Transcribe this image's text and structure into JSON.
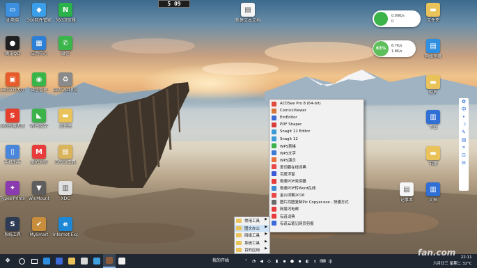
{
  "clock_widget": {
    "time": "5 09"
  },
  "desktop_icons_left": [
    {
      "id": "computer",
      "label": "此电脑",
      "color": "#3d8fe0",
      "glyph": "▭"
    },
    {
      "id": "software",
      "label": "360软件管家",
      "color": "#3a9ee8",
      "glyph": "◆"
    },
    {
      "id": "n360",
      "label": "360浏览器",
      "color": "#2ab34a",
      "glyph": "N"
    },
    {
      "id": "qq",
      "label": "腾讯QQ",
      "color": "#202020",
      "glyph": "●"
    },
    {
      "id": "wincenter",
      "label": "应用中心",
      "color": "#2b7fd6",
      "glyph": "▦"
    },
    {
      "id": "wechat",
      "label": "微信",
      "color": "#3ab54a",
      "glyph": "✆"
    },
    {
      "id": "360center",
      "label": "360游戏大厅",
      "color": "#e85c2c",
      "glyph": "▣"
    },
    {
      "id": "wechatmgr",
      "label": "微信管理",
      "color": "#3ab54a",
      "glyph": "◉"
    },
    {
      "id": "recycle",
      "label": "回收站回收站",
      "color": "#8a8a8a",
      "glyph": "♻"
    },
    {
      "id": "safe360",
      "label": "360杀毒大师",
      "color": "#e53e2c",
      "glyph": "S"
    },
    {
      "id": "wps",
      "label": "WPS文字",
      "color": "#3bb34a",
      "glyph": "◣"
    },
    {
      "id": "folder1",
      "label": "文件夹",
      "color": "#e9c25a",
      "glyph": "▬"
    },
    {
      "id": "phonemgr",
      "label": "手机助手",
      "color": "#4a86d9",
      "glyph": "▯"
    },
    {
      "id": "mumu",
      "label": "美拍大师",
      "color": "#e83c3c",
      "glyph": "M"
    },
    {
      "id": "office",
      "label": "Office工具",
      "color": "#d9b45a",
      "glyph": "▤"
    },
    {
      "id": "types",
      "label": "Types Printing",
      "color": "#8a3bb0",
      "glyph": "✦"
    },
    {
      "id": "winmount",
      "label": "WinMount",
      "color": "#5e5e5e",
      "glyph": "▼"
    },
    {
      "id": "xdc",
      "label": "XDC",
      "color": "#e0e0e0",
      "glyph": "▥"
    },
    {
      "id": "tool",
      "label": "系统工具",
      "color": "#2d3b55",
      "glyph": "S"
    },
    {
      "id": "mystrat",
      "label": "MySmart",
      "color": "#c98e3c",
      "glyph": "✔"
    },
    {
      "id": "ie",
      "label": "Internet Explorer",
      "color": "#1e88d6",
      "glyph": "e"
    }
  ],
  "desktop_icons_right": [
    {
      "id": "doc1",
      "label": "新建文本文档",
      "color": "#f5f5f5",
      "glyph": "▤"
    },
    {
      "id": "folder2",
      "label": "文件夹",
      "color": "#e9c25a",
      "glyph": "▬"
    },
    {
      "id": "wifi",
      "label": "网络连接",
      "color": "#2f8fe0",
      "glyph": "▤"
    },
    {
      "id": "photo",
      "label": "照片",
      "color": "#e9c25a",
      "glyph": "▬"
    },
    {
      "id": "dl",
      "label": "下载",
      "color": "#2f6fd6",
      "glyph": "▥"
    },
    {
      "id": "books",
      "label": "书籍",
      "color": "#e9c25a",
      "glyph": "▬"
    },
    {
      "id": "docs",
      "label": "文档",
      "color": "#2f6fd6",
      "glyph": "▥"
    },
    {
      "id": "note",
      "label": "记事本",
      "color": "#f5f5f5",
      "glyph": "▤"
    },
    {
      "id": "mydocs",
      "label": "我的文档",
      "color": "#e9c25a",
      "glyph": "▬"
    }
  ],
  "speed_widget_1": {
    "down": "0.00K/s",
    "up": "0"
  },
  "speed_widget_2": {
    "percent": "63%",
    "down": "6.7K/s",
    "up": "1.8K/s"
  },
  "right_toolbar": [
    "✿",
    "中",
    "•",
    "☽",
    "✎",
    "▤",
    "⌗",
    "⊡",
    "⊟"
  ],
  "context_menu": {
    "items": [
      {
        "label": "ACDSee Pro 8 (64-bit)",
        "color": "#e24a3c"
      },
      {
        "label": "ComicsViewer",
        "color": "#d6743c"
      },
      {
        "label": "EmEditor",
        "color": "#3c6ad6"
      },
      {
        "label": "PDF Shaper",
        "color": "#d63c3c"
      },
      {
        "label": "Snagit 12 Editor",
        "color": "#3c9ad6"
      },
      {
        "label": "Snagit 12",
        "color": "#3c9ad6"
      },
      {
        "label": "WPS表格",
        "color": "#3bb34a"
      },
      {
        "label": "WPS文字",
        "color": "#3c7ad6"
      },
      {
        "label": "WPS演示",
        "color": "#e8703c"
      },
      {
        "label": "爱词霸在线词典",
        "color": "#e84a4a"
      },
      {
        "label": "百度浮窗",
        "color": "#3c5ad6"
      },
      {
        "label": "极速PDF阅读器",
        "color": "#e83c3c"
      },
      {
        "label": "极速PDF转Word在线",
        "color": "#3c8ad6"
      },
      {
        "label": "金山词霸2016",
        "color": "#e84a4a"
      },
      {
        "label": "图片找图复制Pic Copyer.exe - 快捷方式",
        "color": "#6a6a6a"
      },
      {
        "label": "网易闪电邮",
        "color": "#e83c3c"
      },
      {
        "label": "有道词典",
        "color": "#e83c3c"
      },
      {
        "label": "有道云笔记网页剪报",
        "color": "#3c6ad6"
      }
    ],
    "highlighted_index": -1
  },
  "submenu": {
    "items": [
      "常用工具",
      "图文办公",
      "网络工具",
      "系统工具",
      "百的应用"
    ],
    "highlighted_index": 1
  },
  "taskbar": {
    "quickstart_label": "我的开始",
    "time": "22:11",
    "date": "六月廿三 星期二 32°C",
    "accent": "#1f2733"
  },
  "watermark": "fan.com"
}
